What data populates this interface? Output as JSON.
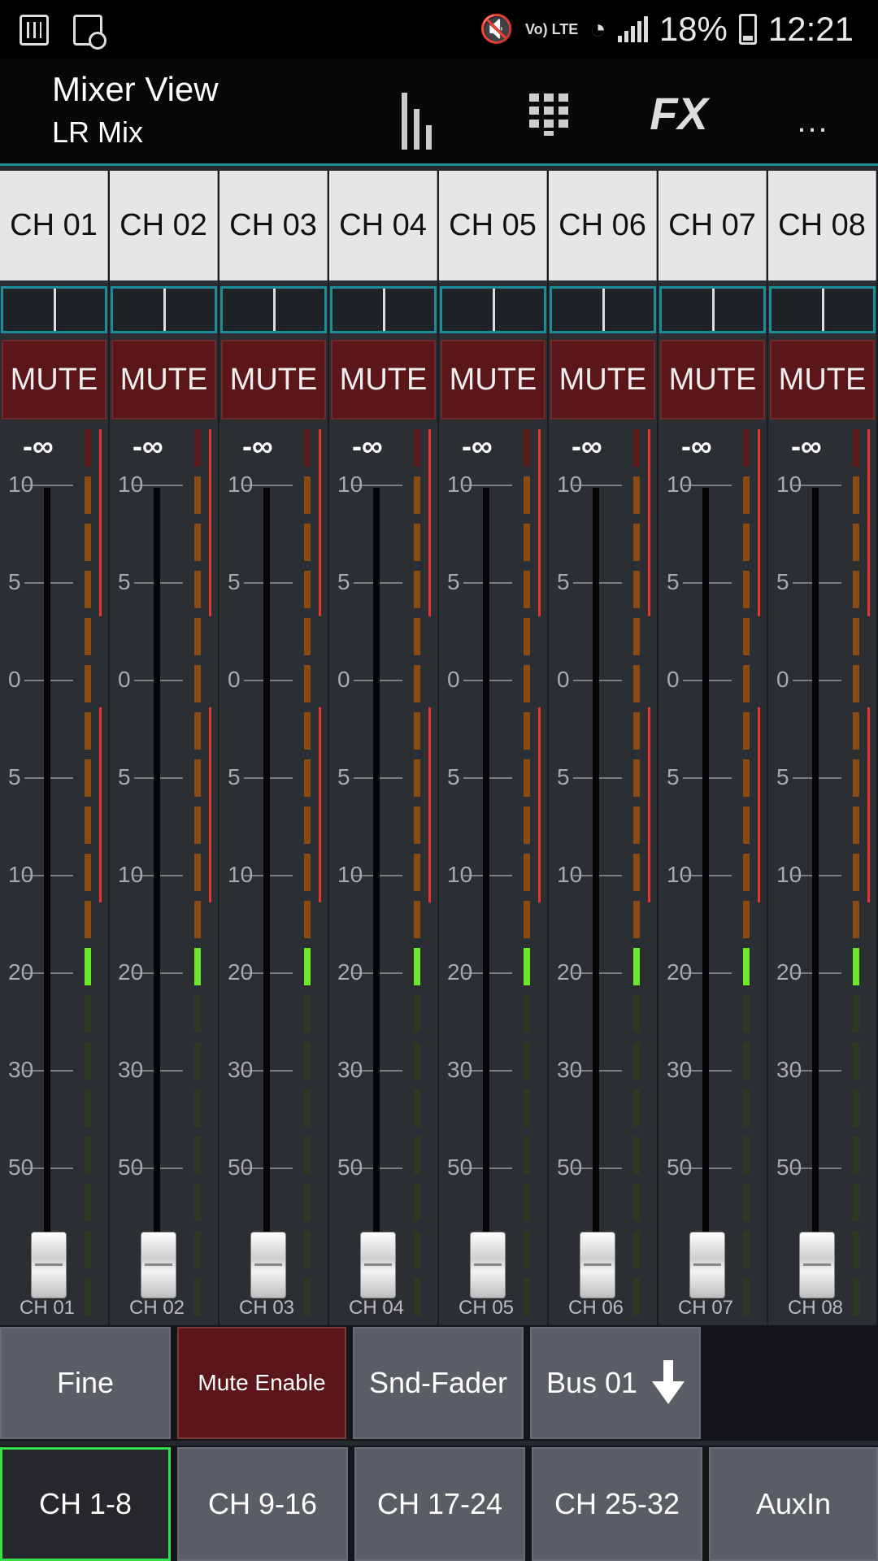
{
  "status_bar": {
    "battery": "18%",
    "time": "12:21",
    "network": "Vo) LTE",
    "icons": [
      "mixer-app-icon",
      "clock-app-icon",
      "muted-speaker-icon",
      "wifi-icon",
      "signal-icon",
      "battery-icon"
    ]
  },
  "app_bar": {
    "title": "Mixer View",
    "subtitle": "LR Mix",
    "fx_label": "FX",
    "more_label": "...",
    "icons": [
      "bars-view-icon",
      "grid-view-icon",
      "more-icon"
    ]
  },
  "channels": [
    {
      "label": "CH 01",
      "mute": "MUTE",
      "level": "-∞",
      "footer": "CH 01"
    },
    {
      "label": "CH 02",
      "mute": "MUTE",
      "level": "-∞",
      "footer": "CH 02"
    },
    {
      "label": "CH 03",
      "mute": "MUTE",
      "level": "-∞",
      "footer": "CH 03"
    },
    {
      "label": "CH 04",
      "mute": "MUTE",
      "level": "-∞",
      "footer": "CH 04"
    },
    {
      "label": "CH 05",
      "mute": "MUTE",
      "level": "-∞",
      "footer": "CH 05"
    },
    {
      "label": "CH 06",
      "mute": "MUTE",
      "level": "-∞",
      "footer": "CH 06"
    },
    {
      "label": "CH 07",
      "mute": "MUTE",
      "level": "-∞",
      "footer": "CH 07"
    },
    {
      "label": "CH 08",
      "mute": "MUTE",
      "level": "-∞",
      "footer": "CH 08"
    }
  ],
  "fader_scale": [
    "10",
    "5",
    "0",
    "5",
    "10",
    "20",
    "30",
    "50"
  ],
  "controls": {
    "fine": "Fine",
    "mute_enable": "Mute Enable",
    "snd_fader": "Snd-Fader",
    "bus": "Bus 01"
  },
  "banks": [
    "CH 1-8",
    "CH 9-16",
    "CH 17-24",
    "CH 25-32",
    "AuxIn"
  ],
  "selected_bank": "CH 1-8",
  "colors": {
    "accent_teal": "#1d8c99",
    "mute_red": "#5a1618",
    "selected_green": "#35e04a",
    "meter_green": "#6be82a",
    "meter_orange": "#8a4a12",
    "peak_red": "#e8332f"
  }
}
